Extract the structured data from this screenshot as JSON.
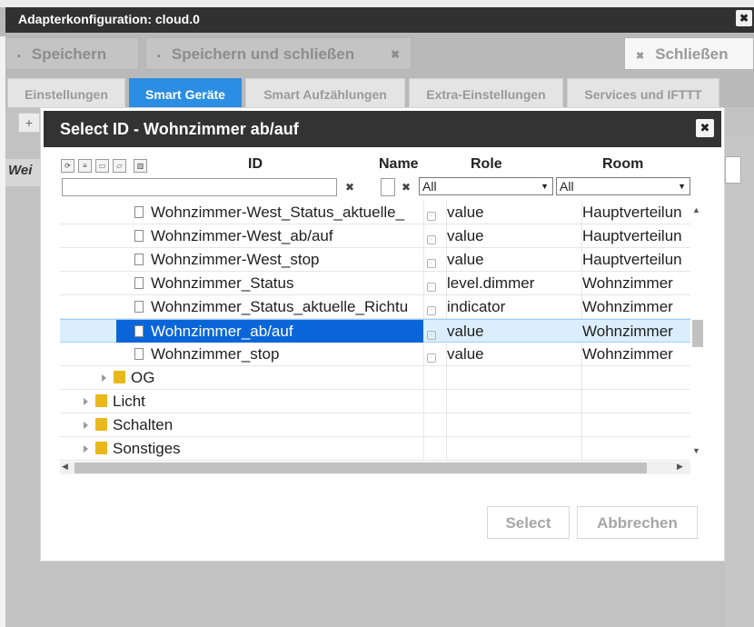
{
  "window": {
    "title": "Adapterkonfiguration: cloud.0",
    "close_glyph": "✖"
  },
  "toolbar": {
    "save_label": "Speichern",
    "save_close_label": "Speichern und schließen",
    "close_label": "Schließen"
  },
  "tabs": [
    {
      "label": "Einstellungen"
    },
    {
      "label": "Smart Geräte"
    },
    {
      "label": "Smart Aufzählungen"
    },
    {
      "label": "Extra-Einstellungen"
    },
    {
      "label": "Services und IFTTT"
    }
  ],
  "background": {
    "partial_label": "Wei",
    "add_symbol": "+"
  },
  "dialog": {
    "title": "Select ID - Wohnzimmer ab/auf",
    "columns": {
      "id": "ID",
      "name": "Name",
      "role": "Role",
      "room": "Room"
    },
    "filters": {
      "id_value": "",
      "role_value": "All",
      "room_value": "All"
    },
    "rows": [
      {
        "id": "Wohnzimmer-West_Status_aktuelle_",
        "role": "value",
        "room": "Hauptverteilun"
      },
      {
        "id": "Wohnzimmer-West_ab/auf",
        "role": "value",
        "room": "Hauptverteilun"
      },
      {
        "id": "Wohnzimmer-West_stop",
        "role": "value",
        "room": "Hauptverteilun"
      },
      {
        "id": "Wohnzimmer_Status",
        "role": "level.dimmer",
        "room": "Wohnzimmer"
      },
      {
        "id": "Wohnzimmer_Status_aktuelle_Richtu",
        "role": "indicator",
        "room": "Wohnzimmer"
      },
      {
        "id": "Wohnzimmer_ab/auf",
        "role": "value",
        "room": "Wohnzimmer",
        "selected": true
      },
      {
        "id": "Wohnzimmer_stop",
        "role": "value",
        "room": "Wohnzimmer"
      }
    ],
    "folders": [
      {
        "label": "OG"
      },
      {
        "label": "Licht"
      },
      {
        "label": "Schalten"
      },
      {
        "label": "Sonstiges"
      }
    ],
    "buttons": {
      "select": "Select",
      "cancel": "Abbrechen"
    }
  }
}
